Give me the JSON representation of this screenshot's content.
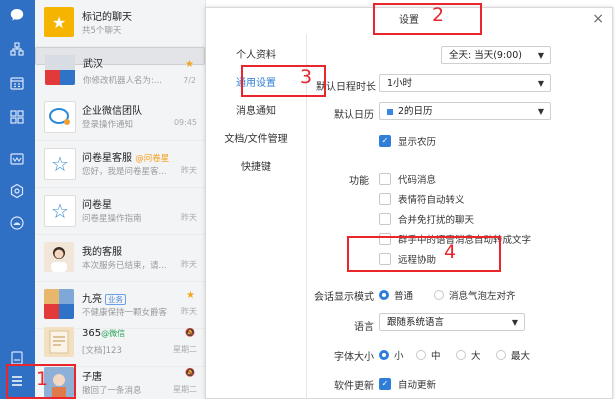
{
  "chat_list": [
    {
      "name": "标记的聊天",
      "preview": "共5个聊天",
      "time": "",
      "extra": "",
      "star": false,
      "mute": false
    },
    {
      "name": "武汉",
      "preview": "你修改机器人名为:...",
      "time": "7/2",
      "extra": "",
      "star": true,
      "mute": false
    },
    {
      "name": "企业微信团队",
      "preview": "登录操作通知",
      "time": "09:45",
      "extra": "",
      "star": false,
      "mute": false
    },
    {
      "name": "问卷星客服",
      "preview": "您好，我是问卷星客...",
      "time": "昨天",
      "extra": "@问卷星",
      "star": false,
      "mute": false
    },
    {
      "name": "问卷星",
      "preview": "问卷星操作指南",
      "time": "昨天",
      "extra": "",
      "star": false,
      "mute": false
    },
    {
      "name": "我的客服",
      "preview": "本次服务已结束，请...",
      "time": "昨天",
      "extra": "",
      "star": false,
      "mute": false
    },
    {
      "name": "九亮",
      "preview": "不健康保持一颗女爵客",
      "time": "昨天",
      "extra": "业务",
      "star": true,
      "mute": false
    },
    {
      "name": "365",
      "preview": "[文档]123",
      "time": "星期二",
      "extra": "@微信",
      "star": false,
      "mute": true
    },
    {
      "name": "子唐",
      "preview": "撤回了一条消息",
      "time": "星期二",
      "extra": "",
      "star": false,
      "mute": true
    }
  ],
  "dialog": {
    "title": "设置",
    "close": "×",
    "nav": [
      "个人资料",
      "通用设置",
      "消息通知",
      "文档/文件管理",
      "快捷键"
    ],
    "workday_select": "全天: 当天(9:00)",
    "default_duration_label": "默认日程时长",
    "default_duration_value": "1小时",
    "default_calendar_label": "默认日历",
    "default_calendar_value": "2的日历",
    "lunar_label": "显示农历",
    "feature_label": "功能",
    "features": [
      "代码消息",
      "表情符自动转义",
      "合并免打扰的聊天",
      "群手中的语音消息自动转成文字",
      "远程协助"
    ],
    "chat_mode_label": "会话显示模式",
    "chat_mode_options": [
      "普通",
      "消息气泡左对齐"
    ],
    "language_label": "语言",
    "language_value": "跟随系统语言",
    "font_size_label": "字体大小",
    "font_size_options": [
      "小",
      "中",
      "大",
      "最大"
    ],
    "update_label": "软件更新",
    "update_value": "自动更新"
  },
  "annotations": [
    "1",
    "2",
    "3",
    "4"
  ],
  "colors": {
    "rail": "#2f6fc4",
    "accent": "#2f7fd8",
    "annotation": "#e8262b"
  }
}
